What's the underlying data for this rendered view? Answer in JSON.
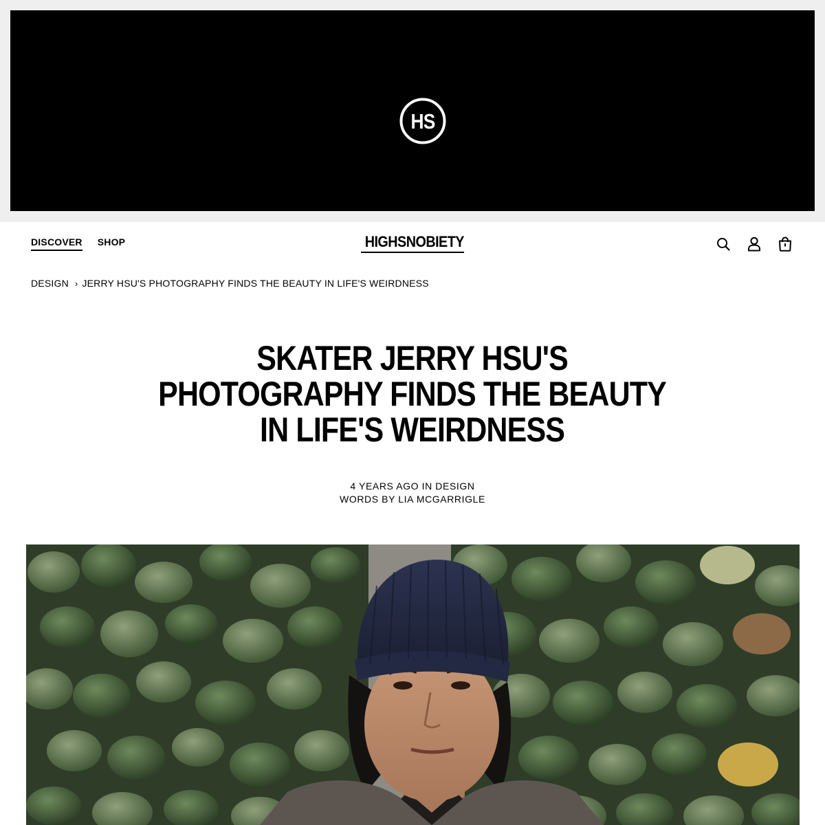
{
  "banner": {
    "logo_text": "HS",
    "colors": {
      "background": "#000000",
      "logo": "#ffffff"
    }
  },
  "nav": {
    "items": [
      {
        "label": "DISCOVER",
        "active": true
      },
      {
        "label": "SHOP",
        "active": false
      }
    ],
    "brand": "HIGHSNOBIETY",
    "icons": [
      "search-icon",
      "account-icon",
      "bag-icon"
    ]
  },
  "breadcrumb": {
    "items": [
      {
        "label": "DESIGN"
      },
      {
        "label": "JERRY HSU'S PHOTOGRAPHY FINDS THE BEAUTY IN LIFE'S WEIRDNESS"
      }
    ],
    "separator": "›"
  },
  "article": {
    "headline_lines": [
      "SKATER JERRY HSU'S",
      "PHOTOGRAPHY FINDS THE BEAUTY",
      "IN LIFE'S WEIRDNESS"
    ],
    "meta": {
      "date_line": "4 YEARS AGO IN DESIGN",
      "byline": "WORDS BY LIA MCGARRIGLE"
    }
  }
}
